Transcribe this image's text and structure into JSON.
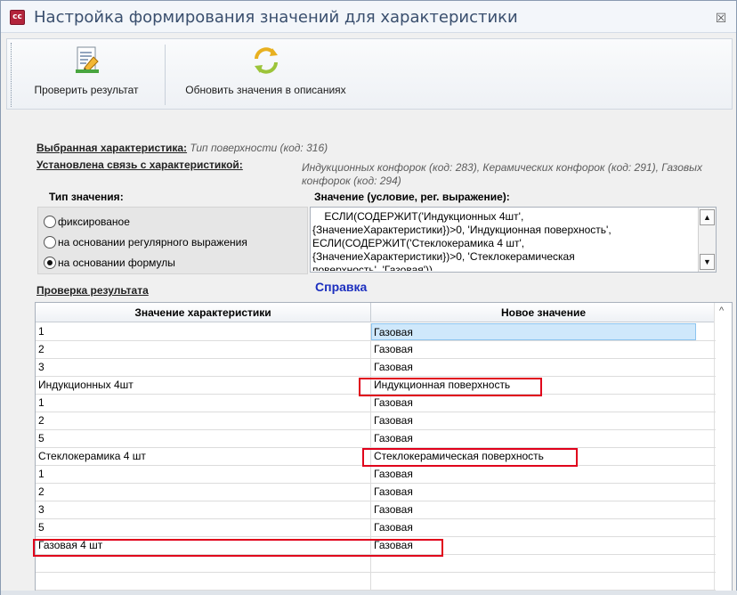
{
  "window": {
    "app_icon": "cc",
    "title": "Настройка формирования значений для характеристики",
    "close_symbol": "☒"
  },
  "toolbar": {
    "check_label": "Проверить результат",
    "refresh_label": "Обновить значения в описаниях",
    "check_icon": "edit-document-icon",
    "refresh_icon": "refresh-arrows-icon"
  },
  "info": {
    "selected_label": "Выбранная характеристика:",
    "selected_value": "Тип поверхности (код: 316)",
    "linked_label": "Установлена связь с характеристикой:",
    "linked_value": "Индукционных конфорок (код: 283), Керамических конфорок (код: 291), Газовых конфорок (код: 294)"
  },
  "value_type": {
    "heading": "Тип значения:",
    "options": [
      {
        "label": "фиксированое",
        "selected": false
      },
      {
        "label": "на основании регулярного выражения",
        "selected": false
      },
      {
        "label": "на основании формулы",
        "selected": true
      }
    ]
  },
  "formula": {
    "heading": "Значение (условие, рег. выражение):",
    "text": "    ЕСЛИ(СОДЕРЖИТ('Индукционных 4шт',\n{ЗначениеХарактеристики})>0, 'Индукционная поверхность',\nЕСЛИ(СОДЕРЖИТ('Стеклокерамика 4 шт',\n{ЗначениеХарактеристики})>0, 'Стеклокерамическая\nповерхность', 'Газовая'))"
  },
  "check": {
    "title": "Проверка результата",
    "help": "Справка"
  },
  "grid": {
    "col1": "Значение характеристики",
    "col2": "Новое значение",
    "rows": [
      {
        "value": "1",
        "new": "Газовая"
      },
      {
        "value": "2",
        "new": "Газовая"
      },
      {
        "value": "3",
        "new": "Газовая"
      },
      {
        "value": "Индукционных 4шт",
        "new": "Индукционная поверхность"
      },
      {
        "value": "1",
        "new": "Газовая"
      },
      {
        "value": "2",
        "new": "Газовая"
      },
      {
        "value": "5",
        "new": "Газовая"
      },
      {
        "value": "Стеклокерамика 4 шт",
        "new": "Стеклокерамическая поверхность"
      },
      {
        "value": "1",
        "new": "Газовая"
      },
      {
        "value": "2",
        "new": "Газовая"
      },
      {
        "value": "3",
        "new": "Газовая"
      },
      {
        "value": "5",
        "new": "Газовая"
      },
      {
        "value": "Газовая 4 шт",
        "new": "Газовая"
      },
      {
        "value": "",
        "new": ""
      },
      {
        "value": "",
        "new": ""
      }
    ]
  },
  "colors": {
    "highlight_border": "#e0001b",
    "help_link": "#1c2fbf",
    "selected_cell": "#cfe8fb"
  }
}
